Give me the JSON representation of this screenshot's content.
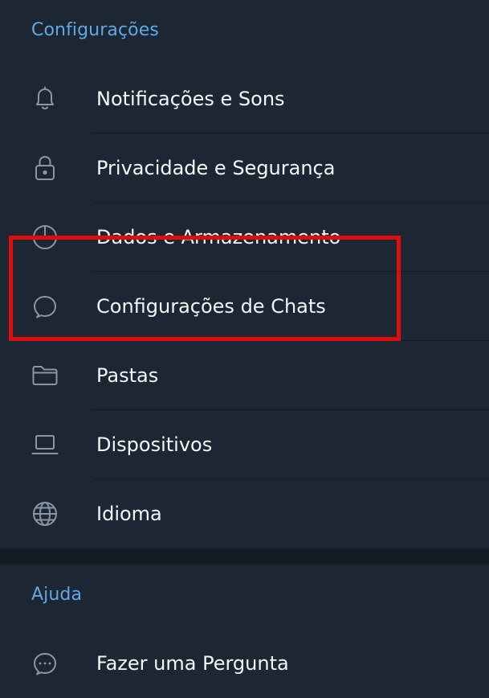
{
  "settings_section": {
    "title": "Configurações",
    "items": [
      {
        "label": "Notificações e Sons",
        "icon": "bell-icon"
      },
      {
        "label": "Privacidade e Segurança",
        "icon": "lock-icon"
      },
      {
        "label": "Dados e Armazenamento",
        "icon": "pie-chart-icon"
      },
      {
        "label": "Configurações de Chats",
        "icon": "chat-bubble-icon"
      },
      {
        "label": "Pastas",
        "icon": "folder-icon"
      },
      {
        "label": "Dispositivos",
        "icon": "laptop-icon"
      },
      {
        "label": "Idioma",
        "icon": "globe-icon"
      }
    ]
  },
  "help_section": {
    "title": "Ajuda",
    "items": [
      {
        "label": "Fazer uma Pergunta",
        "icon": "chat-dots-icon"
      }
    ]
  },
  "colors": {
    "background": "#1d2733",
    "section_title": "#5fa8e6",
    "item_text": "#f3f5f7",
    "icon": "#8a96a3",
    "highlight": "#e00d0d"
  }
}
